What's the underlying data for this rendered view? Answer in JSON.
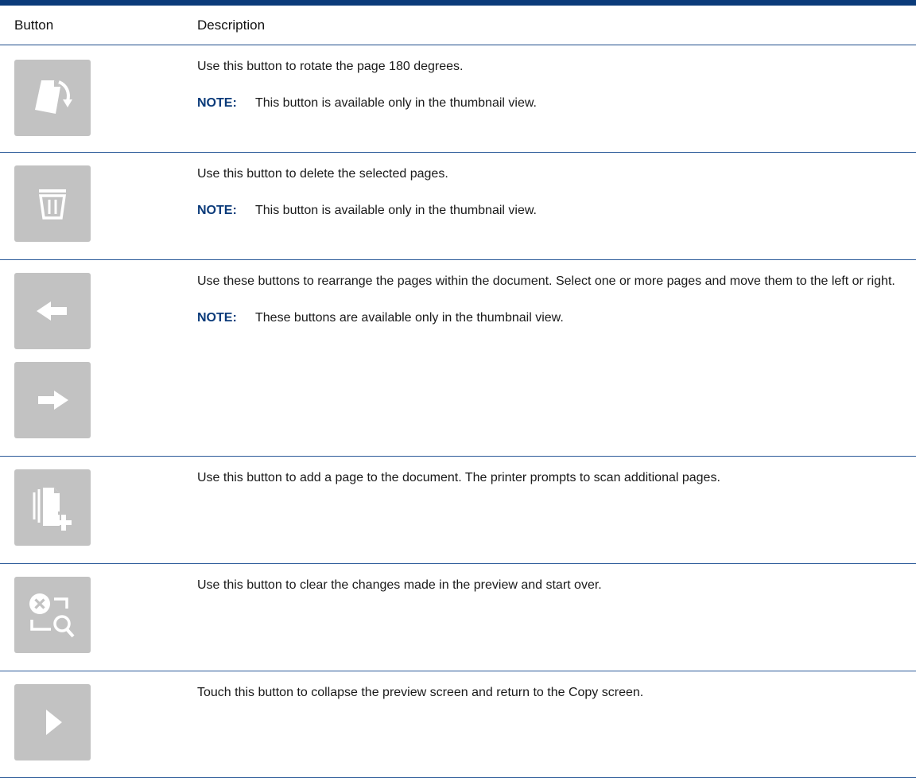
{
  "table": {
    "headers": {
      "button": "Button",
      "description": "Description"
    },
    "note_label": "NOTE:",
    "rows": [
      {
        "icon": "rotate-page-icon",
        "description": "Use this button to rotate the page 180 degrees.",
        "note": "This button is available only in the thumbnail view."
      },
      {
        "icon": "trash-icon",
        "description": "Use this button to delete the selected pages.",
        "note": "This button is available only in the thumbnail view."
      },
      {
        "icon": [
          "arrow-left-icon",
          "arrow-right-icon"
        ],
        "description": "Use these buttons to rearrange the pages within the document. Select one or more pages and move them to the left or right.",
        "note": "These buttons are available only in the thumbnail view."
      },
      {
        "icon": "add-page-icon",
        "description": "Use this button to add a page to the document. The printer prompts to scan additional pages."
      },
      {
        "icon": "clear-preview-icon",
        "description": "Use this button to clear the changes made in the preview and start over."
      },
      {
        "icon": "collapse-preview-icon",
        "description": "Touch this button to collapse the preview screen and return to the Copy screen."
      }
    ]
  },
  "colors": {
    "header_rule": "#0b3b7a",
    "row_rule": "#2b5a99",
    "note_label": "#0b3b7a",
    "button_tile": "#c2c2c2",
    "icon_fill": "#ffffff"
  }
}
